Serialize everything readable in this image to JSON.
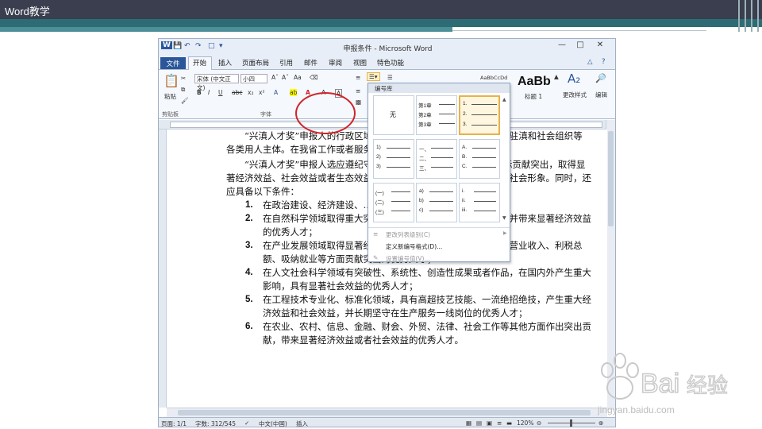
{
  "slide": {
    "title": "Word教学"
  },
  "window": {
    "title": "申报条件 - Microsoft Word",
    "icon_label": "W"
  },
  "tabs": {
    "file": "文件",
    "items": [
      "开始",
      "插入",
      "页面布局",
      "引用",
      "邮件",
      "审阅",
      "视图",
      "特色功能"
    ]
  },
  "ribbon": {
    "paste": "粘贴",
    "clipboard": "剪贴板",
    "font_name": "宋体 (中文正文)",
    "font_size": "小四",
    "font_group": "字体",
    "style_preview": "AaBb",
    "style_name": "标题 1",
    "change_styles": "更改样式",
    "edit": "编辑",
    "style_sample1": "AaBbCcDd",
    "style_sample2": "AaBbCcDd"
  },
  "numbering_dropdown": {
    "header": "编号库",
    "none": "无",
    "chapter": [
      "第1章",
      "第2章",
      "第3章"
    ],
    "arabic_dot": [
      "1.",
      "2.",
      "3."
    ],
    "paren_arabic": [
      "1)",
      "2)",
      "3)"
    ],
    "chinese": [
      "一、",
      "二、",
      "三、"
    ],
    "upper_alpha": [
      "A.",
      "B.",
      "C."
    ],
    "paren_chinese": [
      "(一)",
      "(二)",
      "(三)"
    ],
    "lower_alpha": [
      "a)",
      "b)",
      "c)"
    ],
    "roman": [
      "i.",
      "ii.",
      "iii."
    ],
    "menu": [
      {
        "label": "更改列表级别(C)",
        "disabled": true
      },
      {
        "label": "定义新编号格式(D)...",
        "disabled": false
      },
      {
        "label": "设置编号值(V)...",
        "disabled": true
      }
    ]
  },
  "document": {
    "paragraphs": [
      "“兴滇人才奖”申报人的行政区域内的党政机关、企事业单位、中央驻滇和社会组织等各类用人主体。在我省工作或者服务人才，可同等申报。",
      "“兴滇人才奖”申报人选应遵纪守法，道德品质高尚,工作业绩和实际贡献突出，取得显著经济效益、社会效益或者生态效益，在同行业中广泛认可，具有良好社会形象。同时，还应具备以下条件："
    ],
    "list": [
      {
        "num": "1.",
        "text": "在政治建设、经济建设、…建设中作出突出贡献的优秀人才；"
      },
      {
        "num": "2.",
        "text": "在自然科学领域取得重大突破或者重大技术发明、技术创新，并带来显著经济效益的优秀人才；"
      },
      {
        "num": "3.",
        "text": "在产业发展领域取得显著经济效益和社会效益，特别是在企业营业收入、利税总额、吸纳就业等方面贡献突出的优秀人才；"
      },
      {
        "num": "4.",
        "text": "在人文社会科学领域有突破性、系统性、创造性成果或者作品，在国内外产生重大影响，具有显著社会效益的优秀人才；"
      },
      {
        "num": "5.",
        "text": "在工程技术专业化、标准化领域，具有高超技艺技能、一流绝招绝技，产生重大经济效益和社会效益，并长期坚守在生产服务一线岗位的优秀人才；"
      },
      {
        "num": "6.",
        "text": "在农业、农村、信息、金融、财会、外贸、法律、社会工作等其他方面作出突出贡献，带来显著经济效益或者社会效益的优秀人才。"
      }
    ]
  },
  "status": {
    "page": "页面: 1/1",
    "words": "字数: 312/545",
    "lang": "中文(中国)",
    "mode": "插入",
    "zoom": "120%"
  },
  "watermark": {
    "brand": "Bai",
    "brand2": "经验",
    "url": "jingyan.baidu.com"
  }
}
